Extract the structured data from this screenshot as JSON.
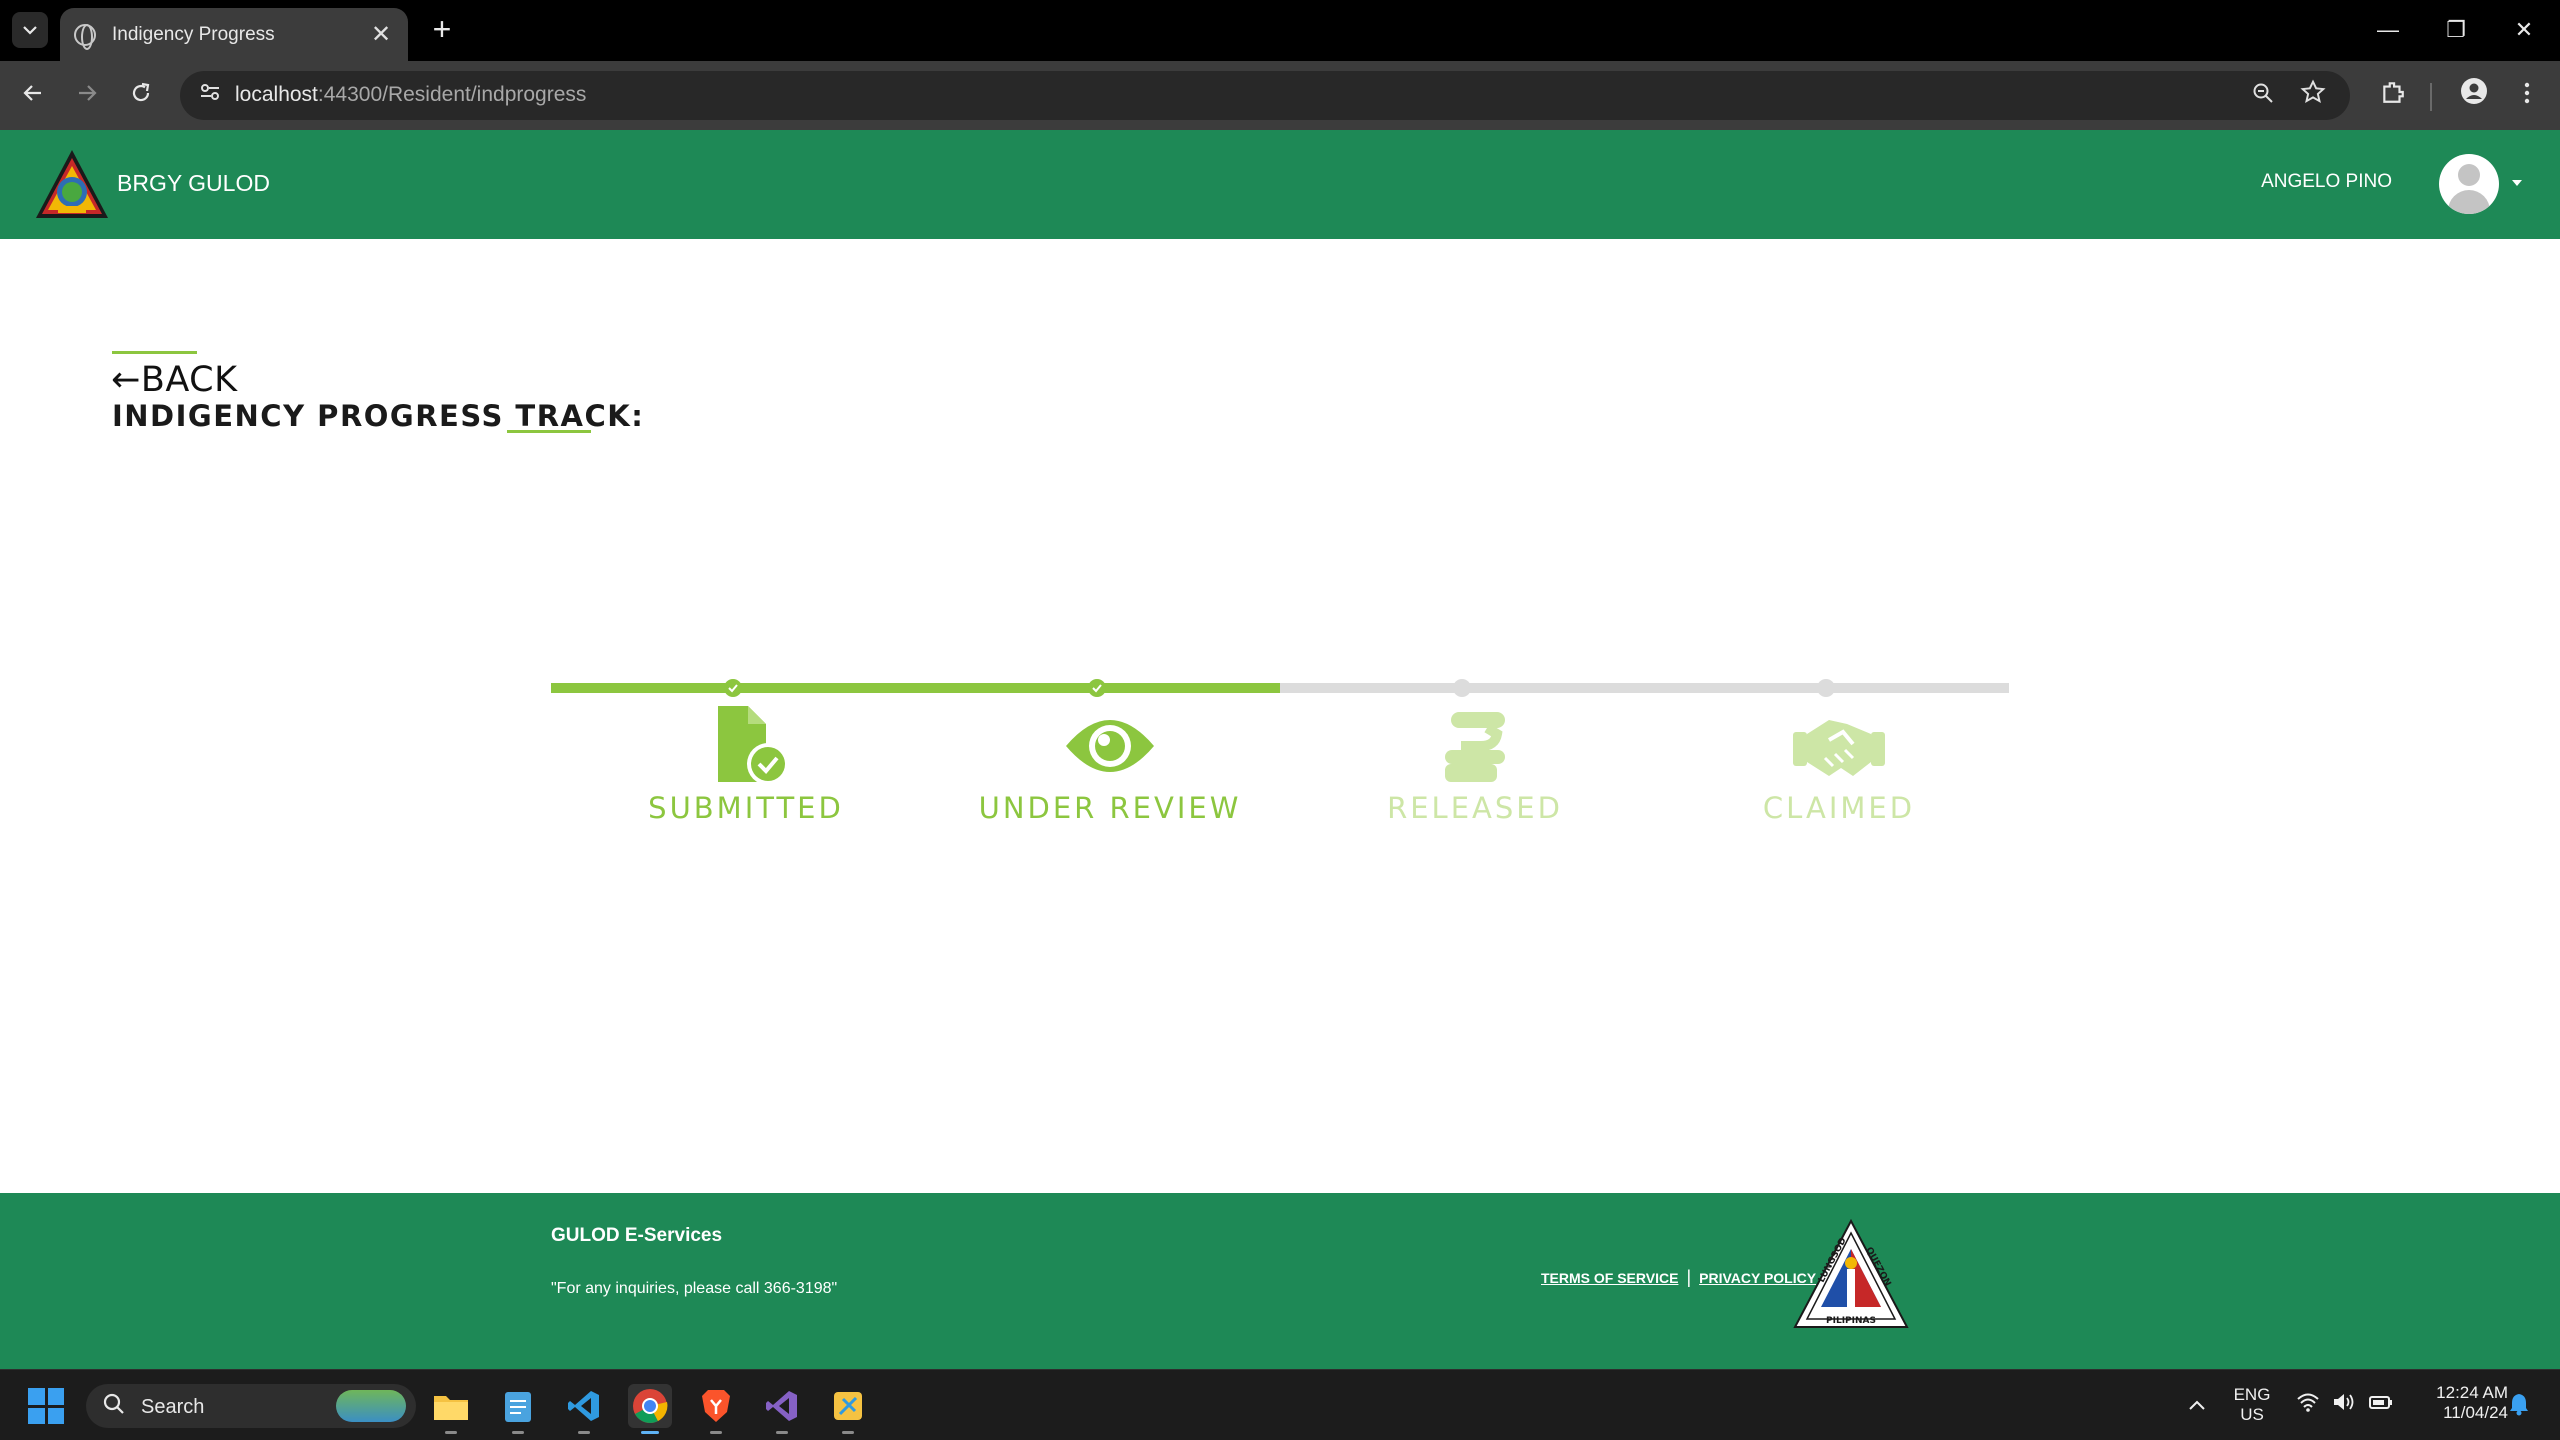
{
  "browser": {
    "tab_title": "Indigency Progress",
    "tab_close": "✕",
    "new_tab": "+",
    "url_host": "localhost",
    "url_rest": ":44300/Resident/indprogress",
    "window_controls": {
      "minimize": "—",
      "restore": "❐",
      "close": "✕"
    }
  },
  "header": {
    "brand": "BRGY GULOD",
    "user": "ANGELO PINO"
  },
  "page": {
    "back_label": "BACK",
    "back_arrow": "←",
    "title": "INDIGENCY PROGRESS TRACK:"
  },
  "progress": {
    "completed_steps": 2,
    "fill_fraction": 0.5,
    "steps": [
      {
        "label": "SUBMITTED",
        "icon": "file-check-icon",
        "status": "done"
      },
      {
        "label": "UNDER REVIEW",
        "icon": "eye-icon",
        "status": "done"
      },
      {
        "label": "RELEASED",
        "icon": "hand-release-icon",
        "status": "pending"
      },
      {
        "label": "CLAIMED",
        "icon": "handshake-icon",
        "status": "pending"
      }
    ],
    "colors": {
      "active": "#8cc63f",
      "inactive": "#cde6a6",
      "track": "#dcdcdc"
    }
  },
  "footer": {
    "title": "GULOD E-Services",
    "note": "\"For any inquiries, please call 366-3198\"",
    "terms": "TERMS OF SERVICE",
    "separator": "|",
    "privacy": "PRIVACY POLICY",
    "seal_text_left": "LUNGSOD",
    "seal_text_right": "QUEZON",
    "seal_text_bottom": "PILIPINAS"
  },
  "taskbar": {
    "search_label": "Search",
    "lang_top": "ENG",
    "lang_bottom": "US",
    "time": "12:24 AM",
    "date": "11/04/24"
  },
  "theme": {
    "brand_green": "#1e8956",
    "accent_green": "#8cc63f"
  }
}
